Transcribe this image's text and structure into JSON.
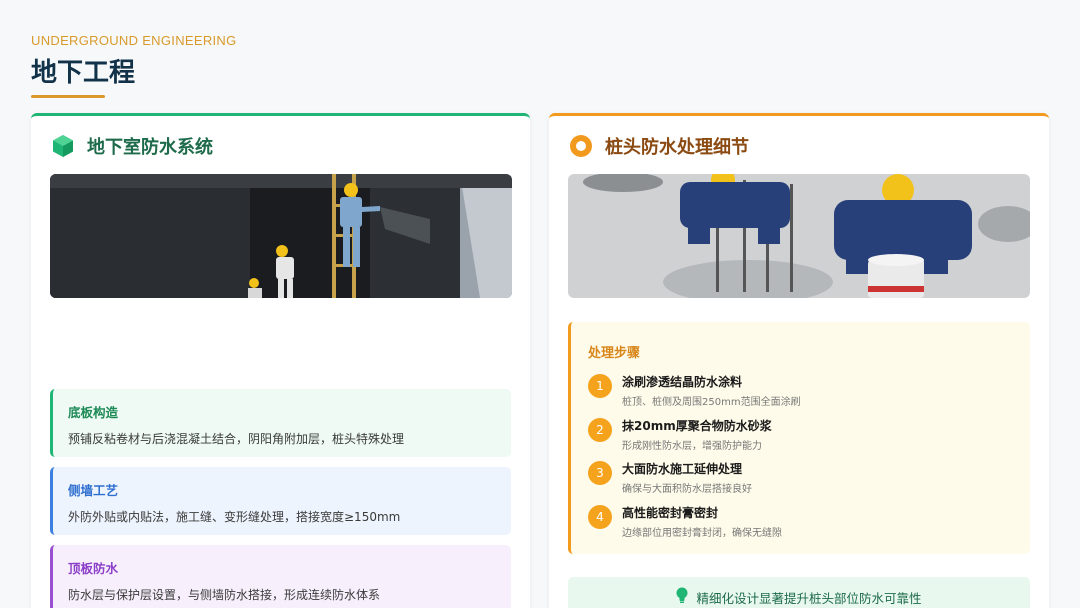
{
  "header": {
    "subtitle": "UNDERGROUND ENGINEERING",
    "title": "地下工程"
  },
  "left_card": {
    "icon": "cube-icon",
    "title": "地下室防水系统",
    "image": "basement-waterproofing-photo",
    "items": [
      {
        "heading": "底板构造",
        "text": "预铺反粘卷材与后浇混凝土结合，阴阳角附加层，桩头特殊处理"
      },
      {
        "heading": "侧墙工艺",
        "text": "外防外贴或内贴法，施工缝、变形缝处理，搭接宽度≥150mm"
      },
      {
        "heading": "顶板防水",
        "text": "防水层与保护层设置，与侧墙防水搭接，形成连续防水体系"
      }
    ]
  },
  "right_card": {
    "icon": "ring-icon",
    "title": "桩头防水处理细节",
    "image": "pile-head-treatment-photo",
    "steps_heading": "处理步骤",
    "steps": [
      {
        "num": "1",
        "title": "涂刷渗透结晶防水涂料",
        "desc": "桩顶、桩侧及周围250mm范围全面涂刷"
      },
      {
        "num": "2",
        "title": "抹20mm厚聚合物防水砂浆",
        "desc": "形成刚性防水层，增强防护能力"
      },
      {
        "num": "3",
        "title": "大面防水施工延伸处理",
        "desc": "确保与大面积防水层搭接良好"
      },
      {
        "num": "4",
        "title": "高性能密封膏密封",
        "desc": "边缘部位用密封膏封闭，确保无缝隙"
      }
    ],
    "tip_icon": "lightbulb-icon",
    "tip": "精细化设计显著提升桩头部位防水可靠性"
  },
  "colors": {
    "green": "#1fb574",
    "orange": "#f29a1e",
    "blue": "#3c7fe0",
    "purple": "#9a4fd0",
    "navy": "#12324a"
  }
}
